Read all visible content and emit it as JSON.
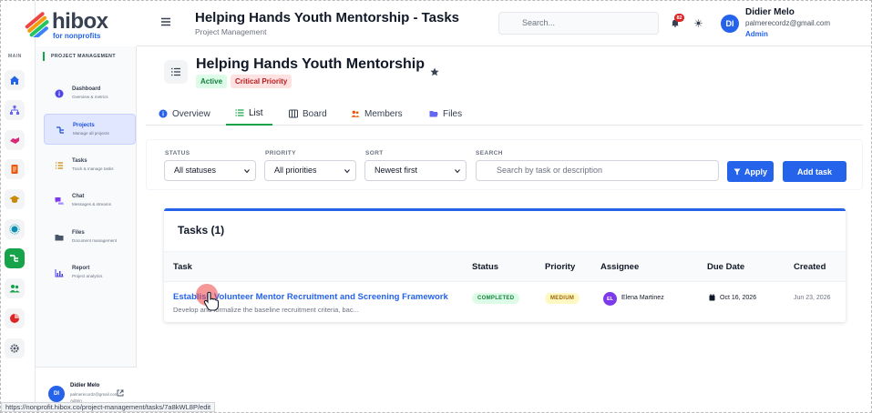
{
  "brand": {
    "name": "hibox",
    "tagline": "for nonprofits"
  },
  "rail": {
    "section_label": "MAIN"
  },
  "sidebar": {
    "section_title": "PROJECT MANAGEMENT",
    "items": [
      {
        "title": "Dashboard",
        "desc": "Overview & metrics"
      },
      {
        "title": "Projects",
        "desc": "Manage all projects"
      },
      {
        "title": "Tasks",
        "desc": "Track & manage tasks"
      },
      {
        "title": "Chat",
        "desc": "Messages & streams"
      },
      {
        "title": "Files",
        "desc": "Document management"
      },
      {
        "title": "Report",
        "desc": "Project analytics"
      }
    ],
    "user": {
      "initials": "DI",
      "name": "Didier Melo",
      "email": "palmerecordz@gmail.com",
      "role": "Admin"
    }
  },
  "header": {
    "title": "Helping Hands Youth Mentorship - Tasks",
    "subtitle": "Project Management",
    "search_placeholder": "Search...",
    "notification_count": "82",
    "user": {
      "initials": "DI",
      "name": "Didier Melo",
      "email": "palmerecordz@gmail.com",
      "role": "Admin"
    }
  },
  "project": {
    "title": "Helping Hands Youth Mentorship",
    "status": "Active",
    "priority": "Critical Priority"
  },
  "tabs": [
    {
      "label": "Overview"
    },
    {
      "label": "List"
    },
    {
      "label": "Board"
    },
    {
      "label": "Members"
    },
    {
      "label": "Files"
    }
  ],
  "filters": {
    "status_label": "STATUS",
    "status_value": "All statuses",
    "priority_label": "PRIORITY",
    "priority_value": "All priorities",
    "sort_label": "SORT",
    "sort_value": "Newest first",
    "search_label": "SEARCH",
    "search_placeholder": "Search by task or description",
    "apply_label": "Apply",
    "add_label": "Add task"
  },
  "tasks": {
    "heading": "Tasks (1)",
    "columns": [
      "Task",
      "Status",
      "Priority",
      "Assignee",
      "Due Date",
      "Created"
    ],
    "rows": [
      {
        "title": "Establish Volunteer Mentor Recruitment and Screening Framework",
        "desc": "Develop and formalize the baseline recruitment criteria, bac...",
        "status": "COMPLETED",
        "priority": "MEDIUM",
        "assignee_initials": "EL",
        "assignee": "Elena Martinez",
        "due": "Oct 16, 2026",
        "created": "Jun 23, 2026"
      }
    ]
  },
  "status_bar": {
    "url": "https://nonprofit.hibox.co/project-management/tasks/7a8kWL8P/edit"
  },
  "colors": {
    "accent": "#2563eb",
    "brand_green": "#16a34a",
    "success_bg": "#dcfce7",
    "danger_bg": "#fee2e2"
  }
}
